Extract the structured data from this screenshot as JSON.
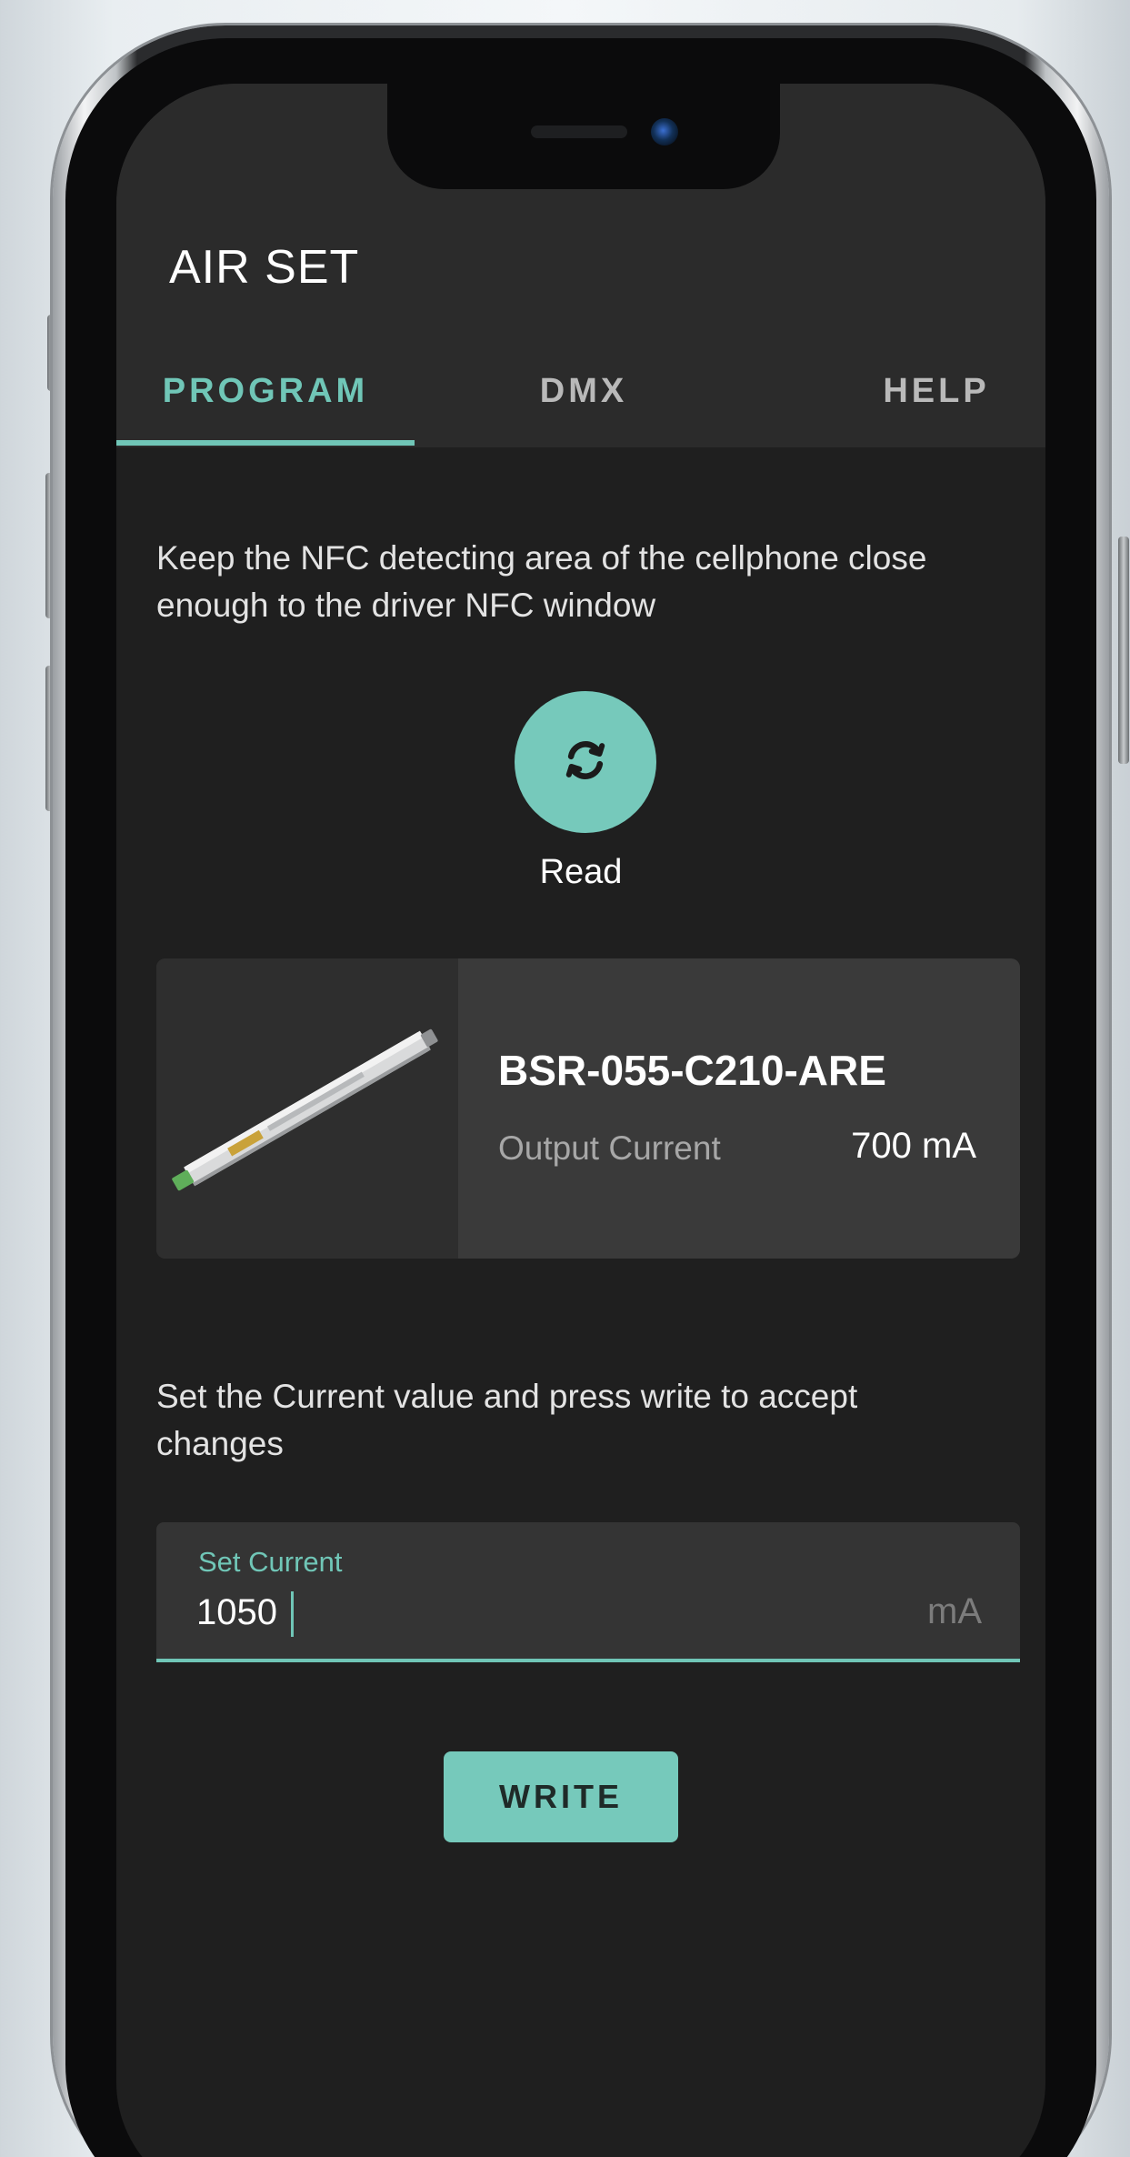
{
  "app": {
    "title": "AIR SET"
  },
  "tabs": [
    {
      "label": "PROGRAM",
      "active": true
    },
    {
      "label": "DMX",
      "active": false
    },
    {
      "label": "HELP",
      "active": false
    }
  ],
  "program": {
    "nfc_instruction": "Keep the NFC detecting area of the cellphone close enough to the driver NFC window",
    "read_button": {
      "icon": "refresh-icon",
      "label": "Read"
    },
    "driver_card": {
      "image": "led-driver-product-image",
      "model": "BSR-055-C210-ARE",
      "output_current_label": "Output Current",
      "output_current_value": "700 mA"
    },
    "set_instruction": "Set the Current value and press write to accept changes",
    "set_current_field": {
      "label": "Set Current",
      "value": "1050",
      "unit": "mA"
    },
    "write_button": {
      "label": "WRITE"
    }
  },
  "colors": {
    "accent": "#70c6b7",
    "button": "#76c9bb",
    "appbar": "#2b2b2b",
    "background": "#1f1f1f",
    "card": "#3a3a3a"
  }
}
